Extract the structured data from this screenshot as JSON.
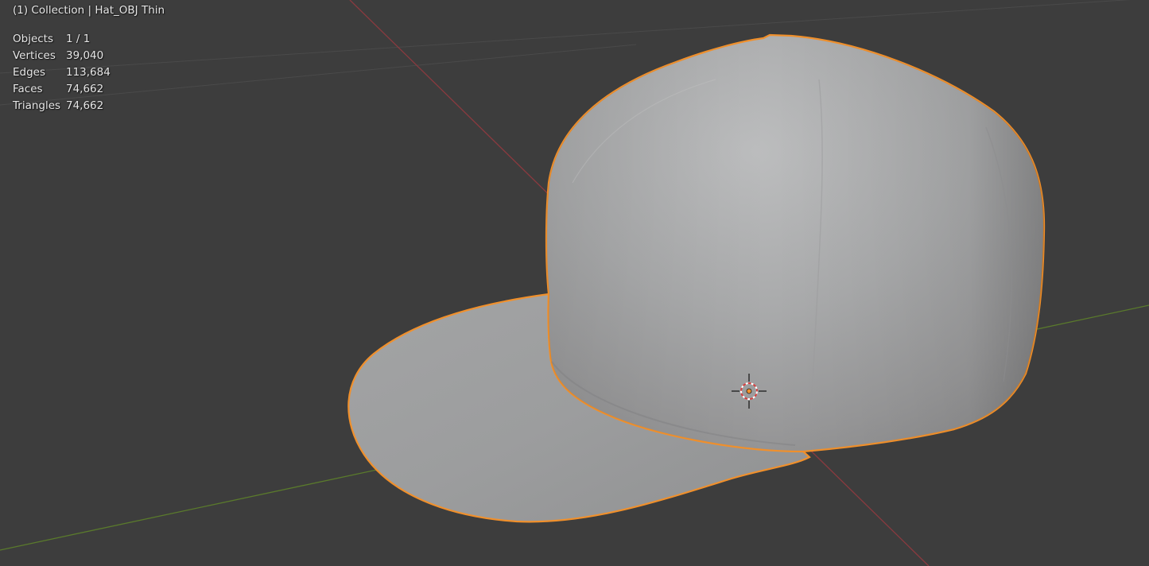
{
  "viewport": {
    "header": "(1) Collection | Hat_OBJ Thin",
    "stats": [
      {
        "label": "Objects",
        "value": "1 / 1"
      },
      {
        "label": "Vertices",
        "value": "39,040"
      },
      {
        "label": "Edges",
        "value": "113,684"
      },
      {
        "label": "Faces",
        "value": "74,662"
      },
      {
        "label": "Triangles",
        "value": "74,662"
      }
    ]
  },
  "colors": {
    "background": "#3d3d3d",
    "grid": "#4a4a4a",
    "x_axis": "#8a3a3f",
    "y_axis": "#5a7a2c",
    "selection_outline": "#f0902c",
    "mesh_light": "#b9babc",
    "mesh_dark": "#8f8f90"
  }
}
